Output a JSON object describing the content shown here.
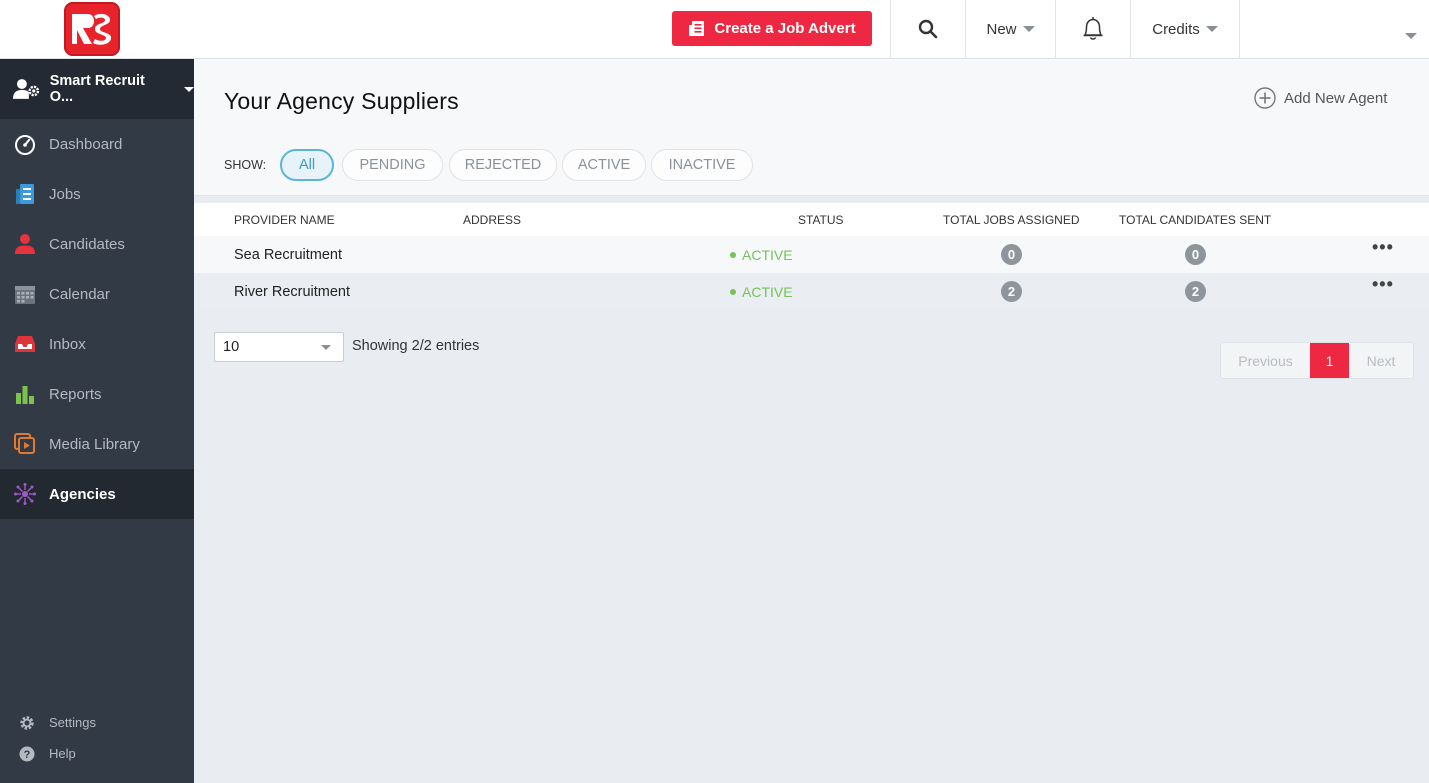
{
  "topbar": {
    "logo": "SR",
    "create_job_label": "Create a Job Advert",
    "search_icon": "search-icon",
    "new_label": "New",
    "bell_icon": "bell-icon",
    "credits_label": "Credits"
  },
  "sidebar": {
    "org_name": "Smart Recruit O...",
    "items": [
      {
        "label": "Dashboard",
        "icon": "dashboard-icon"
      },
      {
        "label": "Jobs",
        "icon": "jobs-icon"
      },
      {
        "label": "Candidates",
        "icon": "candidates-icon"
      },
      {
        "label": "Calendar",
        "icon": "calendar-icon"
      },
      {
        "label": "Inbox",
        "icon": "inbox-icon"
      },
      {
        "label": "Reports",
        "icon": "reports-icon"
      },
      {
        "label": "Media Library",
        "icon": "media-library-icon"
      },
      {
        "label": "Agencies",
        "icon": "agencies-icon"
      }
    ],
    "settings_label": "Settings",
    "help_label": "Help"
  },
  "main": {
    "title": "Your Agency Suppliers",
    "add_agent_label": "Add New Agent",
    "show_label": "SHOW:",
    "filters": [
      "All",
      "PENDING",
      "REJECTED",
      "ACTIVE",
      "INACTIVE"
    ],
    "selected_filter": "All",
    "columns": [
      "PROVIDER NAME",
      "ADDRESS",
      "STATUS",
      "TOTAL JOBS ASSIGNED",
      "TOTAL CANDIDATES SENT"
    ],
    "rows": [
      {
        "name": "Sea Recruitment",
        "address": "",
        "status": "ACTIVE",
        "jobs": "0",
        "candidates": "0",
        "menu": "..."
      },
      {
        "name": "River Recruitment",
        "address": "",
        "status": "ACTIVE",
        "jobs": "2",
        "candidates": "2",
        "menu": "..."
      }
    ],
    "page_size": "10",
    "showing": "Showing 2/2 entries",
    "pager": {
      "previous": "Previous",
      "current": "1",
      "next": "Next"
    }
  },
  "colors": {
    "brand": "#ee2842",
    "sidebar": "#323a45",
    "active_status": "#77c25b",
    "filter_selected": "#5ab6d9"
  }
}
